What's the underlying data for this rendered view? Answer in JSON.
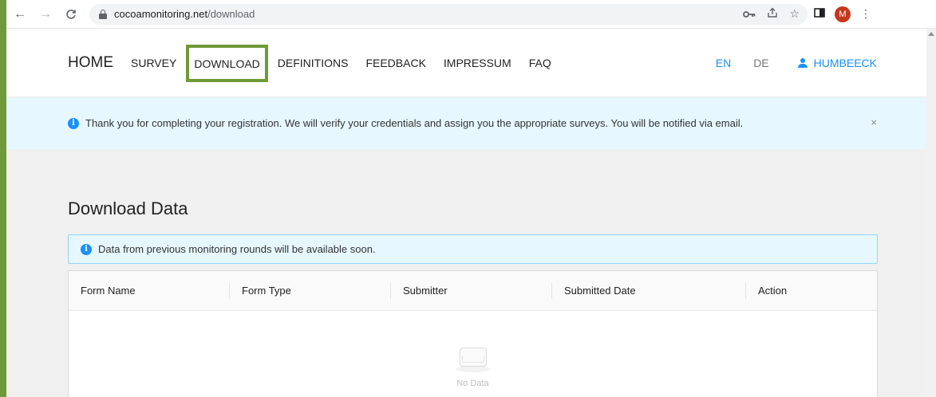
{
  "browser": {
    "url_host": "cocoamonitoring.net",
    "url_path": "/download",
    "avatar_letter": "M",
    "back_icon": "←",
    "forward_icon": "→",
    "reload_icon": "C",
    "key_icon": "⊶",
    "share_icon": "⇧",
    "star_icon": "☆",
    "sidepanel_icon": "◧",
    "menu_icon": "⋮"
  },
  "header": {
    "nav": [
      "HOME",
      "SURVEY",
      "DOWNLOAD",
      "DEFINITIONS",
      "FEEDBACK",
      "IMPRESSUM",
      "FAQ"
    ],
    "lang_en": "EN",
    "lang_de": "DE",
    "user": "HUMBEECK",
    "active_item": "DOWNLOAD",
    "highlight_color": "#6f9a37"
  },
  "banner": {
    "message": "Thank you for completing your registration. We will verify your credentials and assign you the appropriate surveys. You will be notified via email.",
    "close_label": "×",
    "info_glyph": "i"
  },
  "main": {
    "title": "Download Data",
    "notice": "Data from previous monitoring rounds will be available soon.",
    "table": {
      "columns": [
        "Form Name",
        "Form Type",
        "Submitter",
        "Submitted Date",
        "Action"
      ],
      "empty_text": "No Data"
    }
  },
  "colors": {
    "accent": "#1890ff",
    "info_bg": "#e6f7ff"
  }
}
